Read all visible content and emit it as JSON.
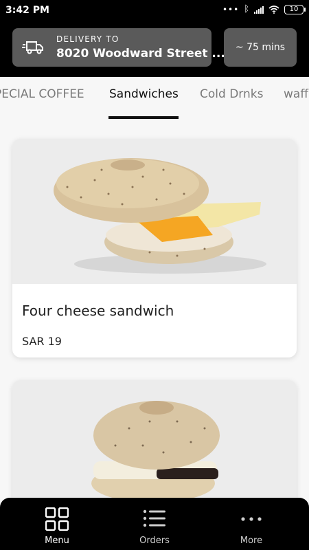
{
  "status_bar": {
    "time": "3:42 PM",
    "battery": "10"
  },
  "header": {
    "delivery_label": "DELIVERY TO",
    "delivery_address": "8020 Woodward Street ...",
    "eta": "~ 75 mins"
  },
  "tabs": [
    {
      "label": "PECIAL COFFEE",
      "active": false
    },
    {
      "label": "Sandwiches",
      "active": true
    },
    {
      "label": "Cold Drnks",
      "active": false
    },
    {
      "label": "waff",
      "active": false
    }
  ],
  "products": [
    {
      "name": "Four cheese sandwich",
      "price": "SAR 19"
    },
    {
      "name": "",
      "price": ""
    }
  ],
  "bottom_nav": [
    {
      "label": "Menu",
      "icon": "grid-icon"
    },
    {
      "label": "Orders",
      "icon": "list-icon"
    },
    {
      "label": "More",
      "icon": "more-dots-icon"
    }
  ],
  "colors": {
    "header_bg": "#000000",
    "card_bg": "#5a5a5a",
    "accent": "#111111"
  }
}
